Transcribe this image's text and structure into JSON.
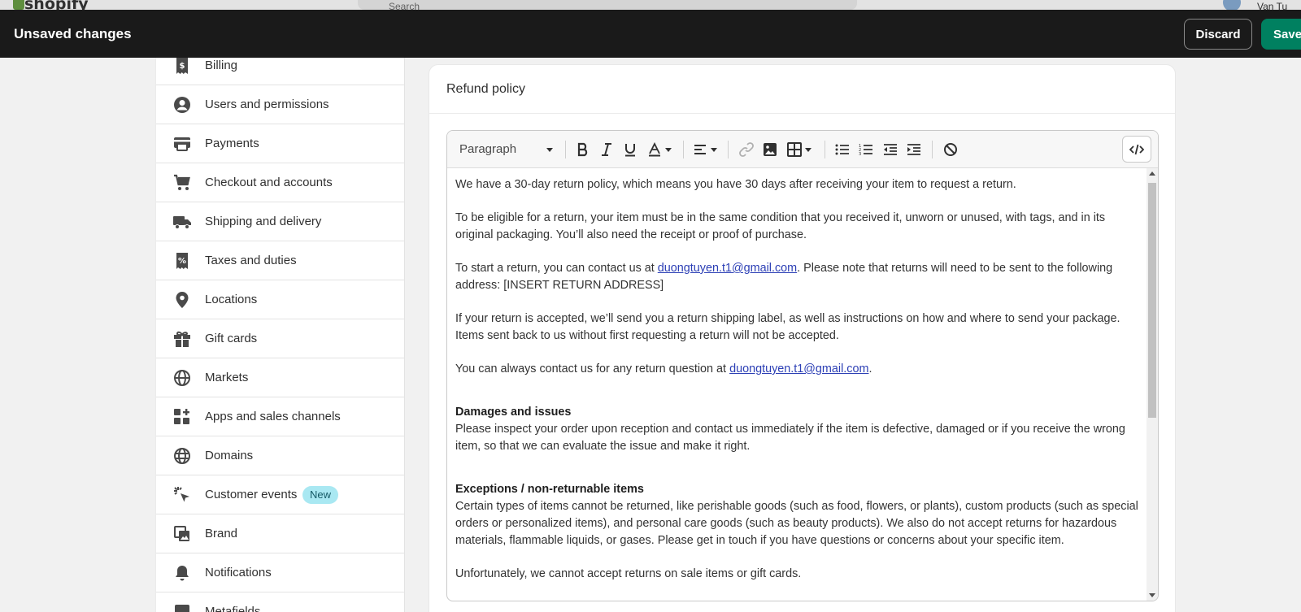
{
  "topbar": {
    "logo": "shopify",
    "search_placeholder": "Search",
    "user_name": "Van Tu"
  },
  "savebar": {
    "title": "Unsaved changes",
    "discard_label": "Discard",
    "save_label": "Save"
  },
  "nav": {
    "items": [
      {
        "label": "Billing",
        "icon": "receipt-icon"
      },
      {
        "label": "Users and permissions",
        "icon": "user-circle-icon"
      },
      {
        "label": "Payments",
        "icon": "credit-card-icon"
      },
      {
        "label": "Checkout and accounts",
        "icon": "cart-icon"
      },
      {
        "label": "Shipping and delivery",
        "icon": "truck-icon"
      },
      {
        "label": "Taxes and duties",
        "icon": "tax-receipt-icon"
      },
      {
        "label": "Locations",
        "icon": "location-pin-icon"
      },
      {
        "label": "Gift cards",
        "icon": "gift-icon"
      },
      {
        "label": "Markets",
        "icon": "globe-icon"
      },
      {
        "label": "Apps and sales channels",
        "icon": "apps-icon"
      },
      {
        "label": "Domains",
        "icon": "world-icon"
      },
      {
        "label": "Customer events",
        "icon": "cursor-click-icon",
        "badge": "New"
      },
      {
        "label": "Brand",
        "icon": "image-icon"
      },
      {
        "label": "Notifications",
        "icon": "bell-icon"
      },
      {
        "label": "Metafields",
        "icon": "metafields-icon"
      }
    ]
  },
  "card": {
    "title": "Refund policy"
  },
  "editor": {
    "format_select": "Paragraph",
    "content": {
      "p1": "We have a 30-day return policy, which means you have 30 days after receiving your item to request a return.",
      "p2": "To be eligible for a return, your item must be in the same condition that you received it, unworn or unused, with tags, and in its original packaging. You’ll also need the receipt or proof of purchase.",
      "p3_before": "To start a return, you can contact us at ",
      "p3_link": "duongtuyen.t1@gmail.com",
      "p3_after": ". Please note that returns will need to be sent to the following address: [INSERT RETURN ADDRESS]",
      "p4": "If your return is accepted, we’ll send you a return shipping label, as well as instructions on how and where to send your package. Items sent back to us without first requesting a return will not be accepted.",
      "p5_before": "You can always contact us for any return question at ",
      "p5_link": "duongtuyen.t1@gmail.com",
      "p5_after": ".",
      "h1": "Damages and issues",
      "p6": "Please inspect your order upon reception and contact us immediately if the item is defective, damaged or if you receive the wrong item, so that we can evaluate the issue and make it right.",
      "h2": "Exceptions / non-returnable items",
      "p7": "Certain types of items cannot be returned, like perishable goods (such as food, flowers, or plants), custom products (such as special orders or personalized items), and personal care goods (such as beauty products). We also do not accept returns for hazardous materials, flammable liquids, or gases. Please get in touch if you have questions or concerns about your specific item.",
      "p8": "Unfortunately, we cannot accept returns on sale items or gift cards."
    }
  },
  "colors": {
    "savebar_bg": "#1a1a1a",
    "save_button": "#008060",
    "link": "#2c3fb5",
    "badge_bg": "#a9e8f2"
  }
}
